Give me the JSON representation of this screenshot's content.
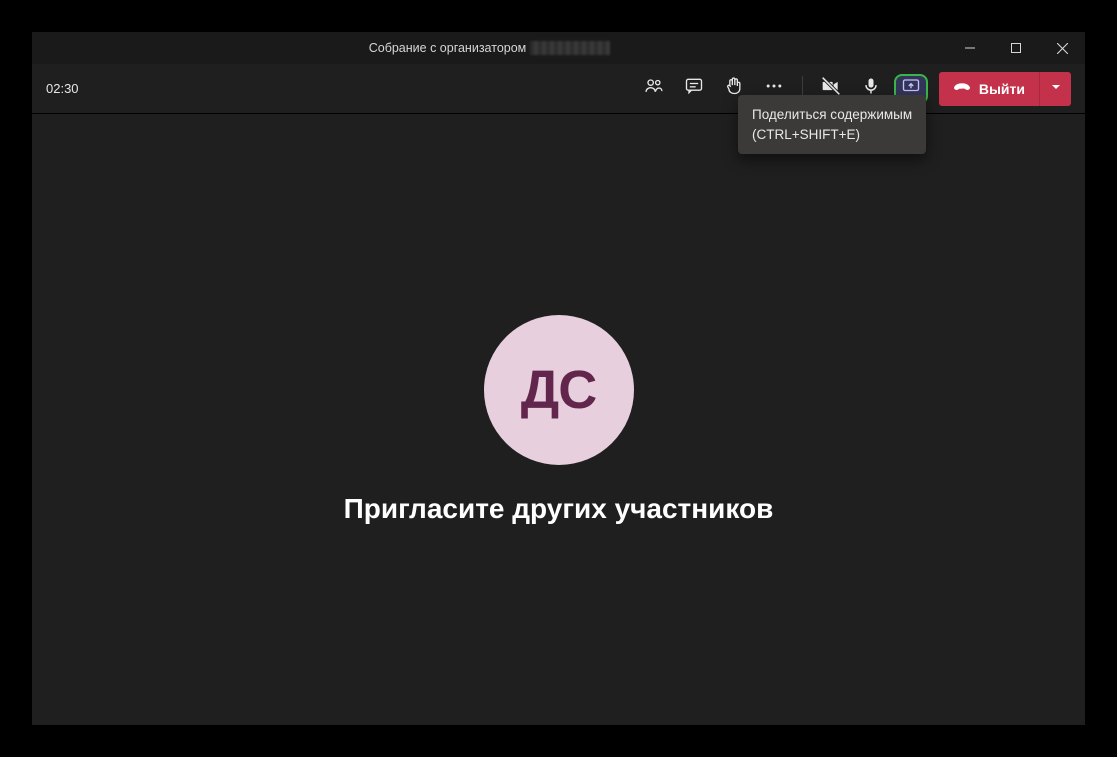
{
  "titlebar": {
    "prefix": "Собрание с организатором"
  },
  "toolbar": {
    "timer": "02:30",
    "leave_label": "Выйти"
  },
  "tooltip": {
    "line1": "Поделиться содержимым",
    "line2": "(CTRL+SHIFT+E)"
  },
  "stage": {
    "avatar_initials": "ДС",
    "invite_text": "Пригласите других участников"
  },
  "colors": {
    "leave_bg": "#c4314b",
    "share_highlight": "#39b54a",
    "avatar_bg": "#e7cfde",
    "avatar_fg": "#62264d"
  }
}
